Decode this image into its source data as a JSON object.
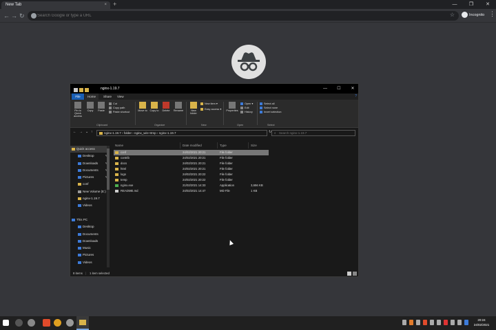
{
  "browser": {
    "tab_title": "New Tab",
    "tab_close": "×",
    "new_tab": "+",
    "back": "←",
    "forward": "→",
    "reload": "↻",
    "omnibox_placeholder": "Search Google or type a URL",
    "profile_label": "Incognito",
    "window_controls": [
      "—",
      "❐",
      "✕"
    ]
  },
  "explorer": {
    "title": "nginx-1.19.7",
    "ribbon_tabs": [
      "File",
      "Home",
      "Share",
      "View"
    ],
    "ribbon": {
      "pin_label": "Pin to Quick access",
      "copy_label": "Copy",
      "paste_label": "Paste",
      "cut_label": "Cut",
      "copy_path_label": "Copy path",
      "paste_shortcut_label": "Paste shortcut",
      "move_to_label": "Move to",
      "copy_to_label": "Copy to",
      "delete_label": "Delete",
      "rename_label": "Rename",
      "new_folder_label": "New folder",
      "new_item_label": "New item ▾",
      "easy_access_label": "Easy access ▾",
      "properties_label": "Properties",
      "open_label": "Open ▾",
      "edit_label": "Edit",
      "history_label": "History",
      "select_all_label": "Select all",
      "select_none_label": "Select none",
      "invert_selection_label": "Invert selection",
      "groups": [
        "Clipboard",
        "Organize",
        "New",
        "Open",
        "Select"
      ]
    },
    "address": {
      "path": [
        "nginx-1.19.7",
        "folder",
        "nginx_win+rtmp",
        "nginx-1.19.7"
      ],
      "search_placeholder": "Search nginx-1.19.7"
    },
    "nav_items": [
      {
        "label": "Quick access",
        "level": 1,
        "selected": true,
        "pin": false,
        "icon": "star-icon"
      },
      {
        "label": "Desktop",
        "level": 2,
        "pin": true,
        "icon": "desktop-icon"
      },
      {
        "label": "Downloads",
        "level": 2,
        "pin": true,
        "icon": "download-icon"
      },
      {
        "label": "Documents",
        "level": 2,
        "pin": true,
        "icon": "documents-icon"
      },
      {
        "label": "Pictures",
        "level": 2,
        "pin": true,
        "icon": "pictures-icon"
      },
      {
        "label": "conf",
        "level": 2,
        "pin": false,
        "icon": "folder-icon"
      },
      {
        "label": "New Volume (E:)",
        "level": 2,
        "pin": false,
        "icon": "drive-icon"
      },
      {
        "label": "nginx-1.19.7",
        "level": 2,
        "pin": false,
        "icon": "folder-icon"
      },
      {
        "label": "Videos",
        "level": 2,
        "pin": false,
        "icon": "videos-icon"
      },
      {
        "label": "",
        "level": 1,
        "pin": false,
        "icon": ""
      },
      {
        "label": "This PC",
        "level": 1,
        "pin": false,
        "icon": "pc-icon"
      },
      {
        "label": "Desktop",
        "level": 2,
        "pin": false,
        "icon": "desktop-icon"
      },
      {
        "label": "Documents",
        "level": 2,
        "pin": false,
        "icon": "documents-icon"
      },
      {
        "label": "Downloads",
        "level": 2,
        "pin": false,
        "icon": "download-icon"
      },
      {
        "label": "Music",
        "level": 2,
        "pin": false,
        "icon": "music-icon"
      },
      {
        "label": "Pictures",
        "level": 2,
        "pin": false,
        "icon": "pictures-icon"
      },
      {
        "label": "Videos",
        "level": 2,
        "pin": false,
        "icon": "videos-icon"
      },
      {
        "label": "Local Disk (C:)",
        "level": 2,
        "pin": false,
        "icon": "drive-icon"
      }
    ],
    "columns": [
      "Name",
      "Date modified",
      "Type",
      "Size"
    ],
    "files": [
      {
        "name": "conf",
        "date": "24/02/2021 20:21",
        "type": "File folder",
        "size": "",
        "kind": "folder",
        "selected": true
      },
      {
        "name": "contrib",
        "date": "24/02/2021 20:21",
        "type": "File folder",
        "size": "",
        "kind": "folder"
      },
      {
        "name": "docs",
        "date": "24/02/2021 20:21",
        "type": "File folder",
        "size": "",
        "kind": "folder"
      },
      {
        "name": "html",
        "date": "24/02/2021 20:21",
        "type": "File folder",
        "size": "",
        "kind": "folder"
      },
      {
        "name": "logs",
        "date": "24/02/2021 20:22",
        "type": "File folder",
        "size": "",
        "kind": "folder"
      },
      {
        "name": "temp",
        "date": "24/02/2021 20:22",
        "type": "File folder",
        "size": "",
        "kind": "folder"
      },
      {
        "name": "nginx.exe",
        "date": "21/02/2021 14:33",
        "type": "Application",
        "size": "3,656 KB",
        "kind": "app"
      },
      {
        "name": "README.md",
        "date": "24/02/2021 14:47",
        "type": "MD File",
        "size": "1 KB",
        "kind": "md"
      }
    ],
    "status_items": "8 items",
    "status_selected": "1 item selected"
  },
  "taskbar": {
    "time": "20:24",
    "date": "24/02/2021"
  }
}
